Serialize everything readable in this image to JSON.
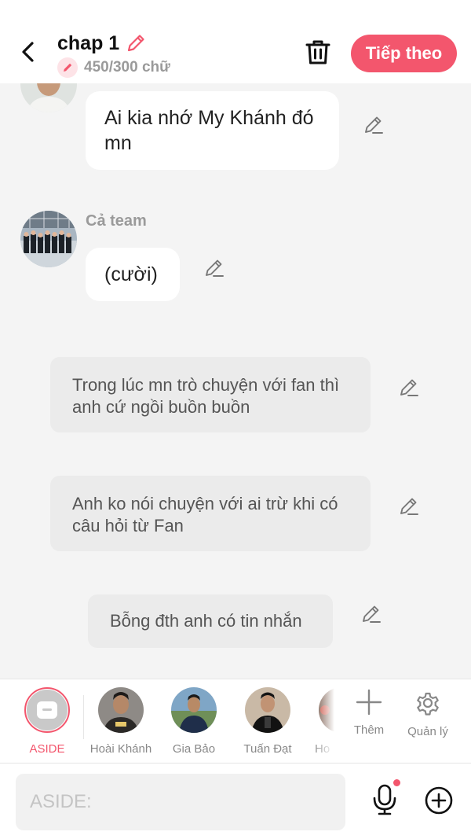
{
  "header": {
    "title": "chap 1",
    "word_count": "450/300 chữ",
    "next_label": "Tiếp theo",
    "accent_color": "#f3566d"
  },
  "messages": [
    {
      "type": "character",
      "sender": "",
      "text": "Ai kia nhớ My Khánh đó mn"
    },
    {
      "type": "character",
      "sender": "Cả team",
      "text": "(cười)"
    },
    {
      "type": "narration",
      "text": "Trong lúc mn trò chuyện với fan thì anh cứ ngồi buồn buồn"
    },
    {
      "type": "narration",
      "text": "Anh ko nói chuyện với ai trừ khi có câu hỏi từ Fan"
    },
    {
      "type": "narration",
      "text": "Bỗng đth anh có tin nhắn"
    }
  ],
  "characters": [
    {
      "name": "ASIDE",
      "selected": true
    },
    {
      "name": "Hoài Khánh"
    },
    {
      "name": "Gia Bảo"
    },
    {
      "name": "Tuấn Đạt"
    },
    {
      "name": "Ho"
    }
  ],
  "tools": {
    "add_label": "Thêm",
    "manage_label": "Quản lý"
  },
  "input": {
    "placeholder": "ASIDE:",
    "value": ""
  }
}
